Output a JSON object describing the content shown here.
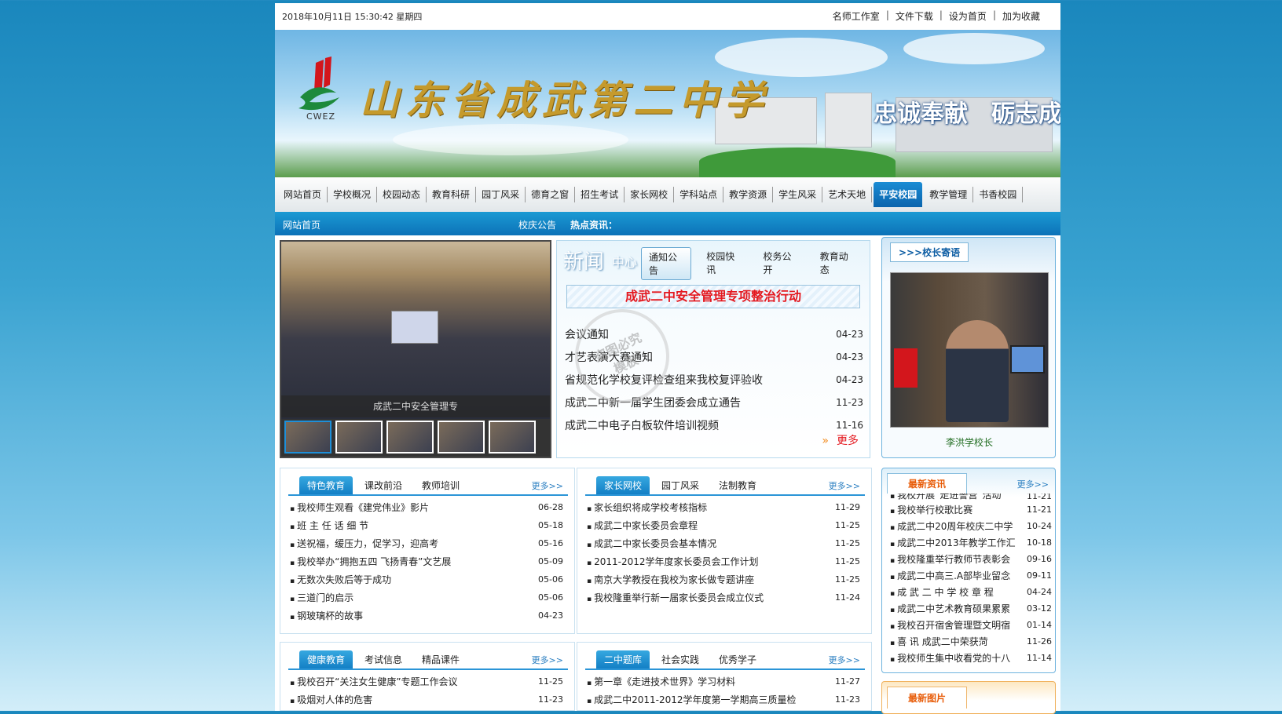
{
  "topbar": {
    "datetime": "2018年10月11日 15:30:42 星期四",
    "links": [
      "名师工作室",
      "文件下载",
      "设为首页",
      "加为收藏"
    ],
    "separator": "|"
  },
  "banner": {
    "school_name": "山东省成武第二中学",
    "logo_text": "CWEZ",
    "slogan": "忠诚奉献　砺志成才"
  },
  "nav": {
    "items": [
      "网站首页",
      "学校概况",
      "校园动态",
      "教育科研",
      "园丁风采",
      "德育之窗",
      "招生考试",
      "家长网校",
      "学科站点",
      "教学资源",
      "学生风采",
      "艺术天地",
      "平安校园",
      "教学管理",
      "书香校园"
    ],
    "active_index": 12
  },
  "subbar": {
    "home": "网站首页",
    "announcement": "校庆公告",
    "hot_label": "热点资讯："
  },
  "slideshow": {
    "caption": "成武二中安全管理专",
    "thumb_count": 5,
    "selected_thumb": 0
  },
  "news_center": {
    "title_big": "新闻",
    "title_small": "中心",
    "tabs": [
      "通知公告",
      "校园快讯",
      "校务公开",
      "教育动态"
    ],
    "active_tab": 0,
    "headline": "成武二中安全管理专项整治行动",
    "items": [
      {
        "title": "会议通知",
        "date": "04-23"
      },
      {
        "title": "才艺表演大赛通知",
        "date": "04-23"
      },
      {
        "title": "省规范化学校复评检查组来我校复评验收",
        "date": "04-23"
      },
      {
        "title": "成武二中新一届学生团委会成立通告",
        "date": "11-23"
      },
      {
        "title": "成武二中电子白板软件培训视频",
        "date": "11-16"
      }
    ],
    "more": "更多",
    "more_icon": "double-chevron-right"
  },
  "principal": {
    "header": ">>>校长寄语",
    "name": "李洪学校长"
  },
  "box_feature": {
    "tabs": [
      "特色教育",
      "课改前沿",
      "教师培训"
    ],
    "more": "更多>>",
    "items": [
      {
        "title": "我校师生观看《建党伟业》影片",
        "date": "06-28"
      },
      {
        "title": "班 主 任 话 细 节",
        "date": "05-18"
      },
      {
        "title": "送祝福，缓压力，促学习，迎高考",
        "date": "05-16"
      },
      {
        "title": "我校举办“拥抱五四 飞扬青春”文艺展",
        "date": "05-09"
      },
      {
        "title": "无数次失败后等于成功",
        "date": "05-06"
      },
      {
        "title": "三道门的启示",
        "date": "05-06"
      },
      {
        "title": "钢玻璃杯的故事",
        "date": "04-23"
      }
    ]
  },
  "box_parent": {
    "tabs": [
      "家长网校",
      "园丁风采",
      "法制教育"
    ],
    "more": "更多>>",
    "items": [
      {
        "title": "家长组织将成学校考核指标",
        "date": "11-29"
      },
      {
        "title": "成武二中家长委员会章程",
        "date": "11-25"
      },
      {
        "title": "成武二中家长委员会基本情况",
        "date": "11-25"
      },
      {
        "title": "2011-2012学年度家长委员会工作计划",
        "date": "11-25"
      },
      {
        "title": "南京大学教授在我校为家长做专题讲座",
        "date": "11-25"
      },
      {
        "title": "我校隆重举行新一届家长委员会成立仪式",
        "date": "11-24"
      }
    ]
  },
  "box_health": {
    "tabs": [
      "健康教育",
      "考试信息",
      "精品课件"
    ],
    "more": "更多>>",
    "items": [
      {
        "title": "我校召开“关注女生健康”专题工作会议",
        "date": "11-25"
      },
      {
        "title": "吸烟对人体的危害",
        "date": "11-23"
      }
    ]
  },
  "box_question": {
    "tabs": [
      "二中题库",
      "社会实践",
      "优秀学子"
    ],
    "more": "更多>>",
    "items": [
      {
        "title": "第一章《走进技术世界》学习材料",
        "date": "11-27"
      },
      {
        "title": "成武二中2011-2012学年度第一学期高三质量检",
        "date": "11-23"
      }
    ]
  },
  "latest_news": {
    "header": "最新资讯",
    "more": "更多>>",
    "items": [
      {
        "title": "我校开展“走进警营”活动",
        "date": "11-21"
      },
      {
        "title": "我校举行校歌比赛",
        "date": "11-21"
      },
      {
        "title": "成武二中20周年校庆二中学",
        "date": "10-24"
      },
      {
        "title": "成武二中2013年教学工作汇",
        "date": "10-18"
      },
      {
        "title": "我校隆重举行教师节表彰会",
        "date": "09-16"
      },
      {
        "title": "成武二中高三.A部毕业留念",
        "date": "09-11"
      },
      {
        "title": "成 武 二 中 学 校 章 程",
        "date": "04-24"
      },
      {
        "title": "成武二中艺术教育硕果累累",
        "date": "03-12"
      },
      {
        "title": "我校召开宿舍管理暨文明宿",
        "date": "01-14"
      },
      {
        "title": "喜 讯 成武二中荣获菏",
        "date": "11-26"
      },
      {
        "title": "我校师生集中收看党的十八",
        "date": "11-14"
      }
    ]
  },
  "latest_pics": {
    "header": "最新图片"
  },
  "watermark": {
    "line1": "盗图必究",
    "line2": "模板"
  },
  "colors": {
    "accent": "#1b8cd4",
    "headline_red": "#e4181f",
    "orange": "#e85d0a"
  }
}
